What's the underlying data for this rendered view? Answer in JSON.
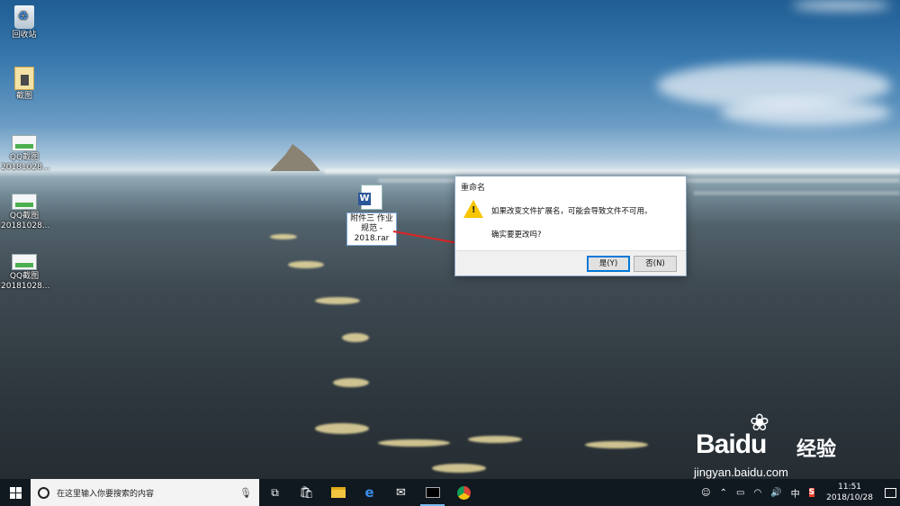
{
  "desktop": {
    "icons": [
      {
        "label": "回收站",
        "icon": "recycle-bin-icon"
      },
      {
        "label": "截图",
        "icon": "picture-folder-icon"
      },
      {
        "label_line1": "QQ截图",
        "label_line2": "20181028...",
        "icon": "screenshot-thumbnail-icon"
      },
      {
        "label_line1": "QQ截图",
        "label_line2": "20181028...",
        "icon": "screenshot-thumbnail-icon"
      },
      {
        "label_line1": "QQ截图",
        "label_line2": "20181028...",
        "icon": "screenshot-thumbnail-icon"
      }
    ],
    "renaming_file": {
      "icon": "word-document-icon",
      "name_line1": "附件三  作业",
      "name_line2": "规范 -",
      "name_line3": "2018.rar"
    }
  },
  "dialog": {
    "title": "重命名",
    "icon": "warning-icon",
    "message": "如果改变文件扩展名，可能会导致文件不可用。",
    "question": "确实要更改吗?",
    "yes_label": "是(Y)",
    "no_label": "否(N)"
  },
  "watermark": {
    "brand": "Bai",
    "brand_suffix": "du",
    "cn": "经验",
    "url": "jingyan.baidu.com"
  },
  "taskbar": {
    "search_placeholder": "在这里输入你要搜索的内容",
    "apps": [
      "task-view-icon",
      "store-icon",
      "file-explorer-icon",
      "edge-icon",
      "mail-icon",
      "terminal-icon",
      "chrome-icon"
    ],
    "tray": {
      "ime": "中",
      "sogou": "S",
      "time": "11:51",
      "date": "2018/10/28"
    }
  },
  "colors": {
    "taskbar_bg": "#101820",
    "accent": "#0078d7",
    "arrow": "#e02424"
  }
}
